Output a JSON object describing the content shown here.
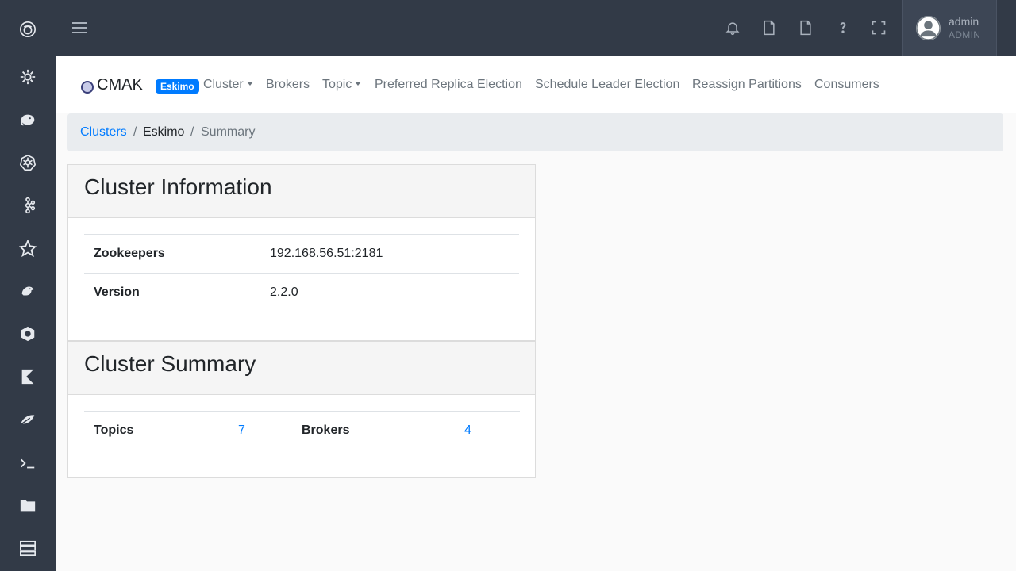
{
  "topbar": {
    "user_name": "admin",
    "user_role": "ADMIN"
  },
  "navbar": {
    "brand": "CMAK",
    "cluster_badge": "Eskimo",
    "links": {
      "cluster": "Cluster",
      "brokers": "Brokers",
      "topic": "Topic",
      "preferred_replica": "Preferred Replica Election",
      "schedule_leader": "Schedule Leader Election",
      "reassign": "Reassign Partitions",
      "consumers": "Consumers"
    }
  },
  "breadcrumb": {
    "clusters": "Clusters",
    "sep1": "/",
    "cluster": "Eskimo",
    "sep2": "/",
    "current": "Summary"
  },
  "cluster_info": {
    "title": "Cluster Information",
    "rows": [
      {
        "label": "Zookeepers",
        "value": "192.168.56.51:2181"
      },
      {
        "label": "Version",
        "value": "2.2.0"
      }
    ]
  },
  "cluster_summary": {
    "title": "Cluster Summary",
    "topics_label": "Topics",
    "topics_value": "7",
    "brokers_label": "Brokers",
    "brokers_value": "4"
  },
  "icons": {
    "sidebar": [
      "eskimo-logo-icon",
      "gear-icon",
      "elephant-icon",
      "kubernetes-icon",
      "kafka-icon",
      "spark-star-icon",
      "python-bird-icon",
      "ring-icon",
      "kibana-icon",
      "feather-icon",
      "terminal-icon",
      "folder-icon",
      "server-icon"
    ],
    "topbar": [
      "hamburger-icon",
      "bell-icon",
      "file-icon",
      "file-icon",
      "question-icon",
      "fullscreen-icon"
    ]
  },
  "colors": {
    "sidebar_bg": "#323a47",
    "accent": "#007bff",
    "breadcrumb_bg": "#e9ecef"
  }
}
